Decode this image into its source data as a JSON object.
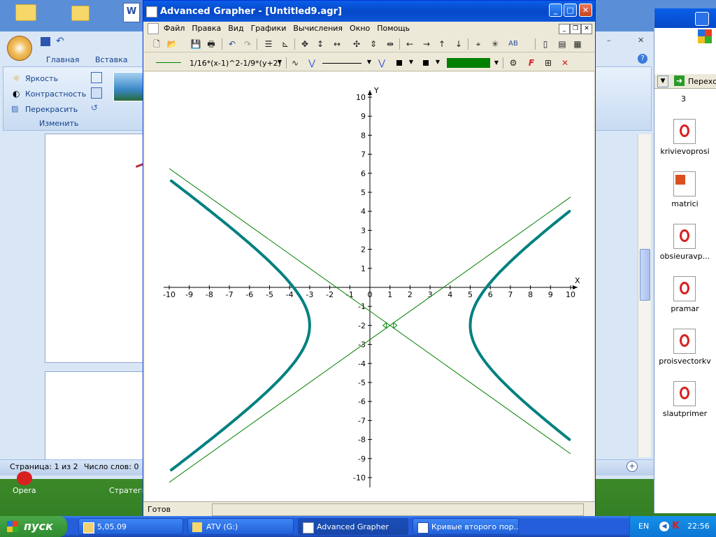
{
  "desktop": {
    "icons": [
      {
        "label": "Opera"
      },
      {
        "label": "Стратеги"
      }
    ]
  },
  "word": {
    "tabs": [
      "Главная",
      "Вставка"
    ],
    "image_group": {
      "items": [
        "Яркость",
        "Контрастность",
        "Перекрасить"
      ],
      "group_label": "Изменить"
    },
    "status": {
      "page": "Страница: 1 из 2",
      "words": "Число слов: 0"
    }
  },
  "explorer": {
    "go_label": "Переход",
    "first_item": "3",
    "files": [
      "krivievoprosi",
      "matrici",
      "obsieuravp...",
      "pramar",
      "proisvectorkv",
      "slautprimer"
    ]
  },
  "grapher": {
    "title": "Advanced Grapher - [Untitled9.agr]",
    "menu": [
      "Файл",
      "Правка",
      "Вид",
      "Графики",
      "Вычисления",
      "Окно",
      "Помощь"
    ],
    "graph_selector": "1/16*(x-1)^2-1/9*(y+2)",
    "line_color": "#008000",
    "curve_color": "#008080",
    "status_text": "Готов",
    "chart_data": {
      "type": "line",
      "title": "",
      "xlabel": "X",
      "ylabel": "Y",
      "xlim": [
        -10,
        10
      ],
      "ylim": [
        -10,
        10
      ],
      "x_ticks": [
        -10,
        -9,
        -8,
        -7,
        -6,
        -5,
        -4,
        -3,
        -2,
        -1,
        0,
        1,
        2,
        3,
        4,
        5,
        6,
        7,
        8,
        9,
        10
      ],
      "y_ticks": [
        10,
        9,
        8,
        7,
        6,
        5,
        4,
        3,
        2,
        1,
        -1,
        -2,
        -3,
        -4,
        -5,
        -6,
        -7,
        -8,
        -9,
        -10
      ],
      "series": [
        {
          "name": "1/16*(x-1)^2-1/9*(y+2)",
          "equation": "(x-1)^2/16 - (y+2)^2/9 = 1",
          "center": [
            1,
            -2
          ],
          "a": 4,
          "b": 3
        },
        {
          "equation": "y + 2 = 0.75 (x - 1)"
        },
        {
          "equation": "y + 2 = -0.75 (x - 1)"
        }
      ]
    }
  },
  "taskbar": {
    "start": "пуск",
    "tasks": [
      "5,05.09",
      "ATV (G:)",
      "Advanced Grapher",
      "Кривые второго пор..."
    ],
    "lang": "EN",
    "clock": "22:56"
  }
}
